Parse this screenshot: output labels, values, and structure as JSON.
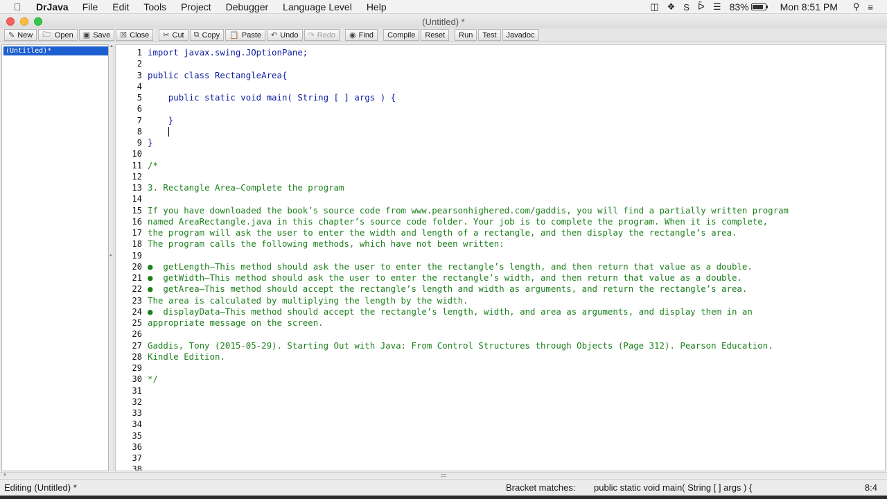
{
  "menubar": {
    "app_name": "DrJava",
    "items": [
      "File",
      "Edit",
      "Tools",
      "Project",
      "Debugger",
      "Language Level",
      "Help"
    ],
    "battery_percent": "83%",
    "battery_level": 0.83,
    "clock": "Mon 8:51 PM",
    "status_icons": [
      "camera-icon",
      "dropbox-icon",
      "skype-icon",
      "bluetooth-icon",
      "wifi-icon",
      "search-icon",
      "list-icon"
    ]
  },
  "window": {
    "title": "(Untitled) *"
  },
  "toolbar": {
    "new": "New",
    "open": "Open",
    "save": "Save",
    "close": "Close",
    "cut": "Cut",
    "copy": "Copy",
    "paste": "Paste",
    "undo": "Undo",
    "redo": "Redo",
    "find": "Find",
    "compile": "Compile",
    "reset": "Reset",
    "run": "Run",
    "test": "Test",
    "javadoc": "Javadoc"
  },
  "doclist": {
    "items": [
      "(Untitled)*"
    ]
  },
  "editor": {
    "line_numbers": [
      "1",
      "2",
      "3",
      "4",
      "5",
      "6",
      "7",
      "8",
      "9",
      "10",
      "11",
      "12",
      "13",
      "14",
      "15",
      "16",
      "17",
      "18",
      "19",
      "20",
      "21",
      "22",
      "23",
      "24",
      "25",
      "26",
      "27",
      "28",
      "29",
      "30",
      "31",
      "32",
      "33",
      "34",
      "35",
      "36",
      "37",
      "38"
    ],
    "lines": [
      "import javax.swing.JOptionPane;",
      "",
      "public class RectangleArea{",
      "",
      "    public static void main( String [ ] args ) {",
      "",
      "    }",
      "",
      "}",
      "",
      "/*",
      "",
      "3. Rectangle Area—Complete the program",
      "",
      "If you have downloaded the book’s source code from www.pearsonhighered.com/gaddis, you will find a partially written program",
      "named AreaRectangle.java in this chapter’s source code folder. Your job is to complete the program. When it is complete,",
      "the program will ask the user to enter the width and length of a rectangle, and then display the rectangle’s area.",
      "The program calls the following methods, which have not been written:",
      "",
      "●  getLength—This method should ask the user to enter the rectangle’s length, and then return that value as a double.",
      "●  getWidth—This method should ask the user to enter the rectangle’s width, and then return that value as a double.",
      "●  getArea—This method should accept the rectangle’s length and width as arguments, and return the rectangle’s area.",
      "The area is calculated by multiplying the length by the width.",
      "●  displayData—This method should accept the rectangle’s length, width, and area as arguments, and display them in an",
      "appropriate message on the screen.",
      "",
      "Gaddis, Tony (2015-05-29). Starting Out with Java: From Control Structures through Objects (Page 312). Pearson Education.",
      "Kindle Edition.",
      "",
      "*/"
    ],
    "comment_start_line": 11,
    "caret_line": 8,
    "caret_column": 4
  },
  "statusbar": {
    "editing": "Editing (Untitled) *",
    "bracket_label": "Bracket matches:",
    "bracket_value": "public static void main( String [ ] args ) {",
    "position": "8:4"
  },
  "colors": {
    "code": "#0b1c9e",
    "comment": "#1b7f1b",
    "selection": "#1d5fd0"
  }
}
